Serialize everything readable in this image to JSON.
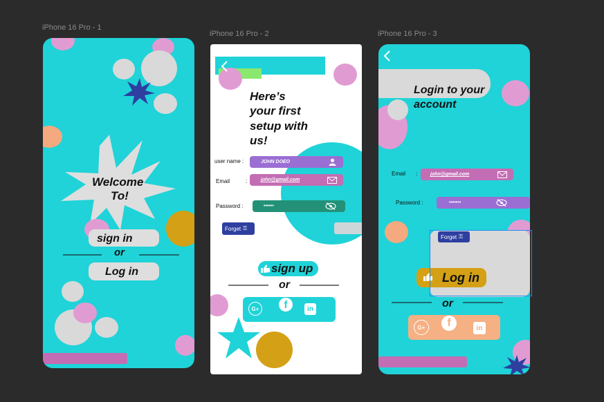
{
  "frames": {
    "one": {
      "label": "iPhone 16 Pro - 1"
    },
    "two": {
      "label": "iPhone 16 Pro - 2"
    },
    "three": {
      "label": "iPhone 16 Pro - 3"
    }
  },
  "screen1": {
    "welcome_line1": "Welcome",
    "welcome_line2": "To!",
    "signin_label": "sign  in",
    "or_label": "or",
    "login_label": "Log in"
  },
  "screen2": {
    "heading_l1": "Here’s",
    "heading_l2": "your first",
    "heading_l3": "setup with",
    "heading_l4": "us!",
    "username_label": "user name :",
    "username_value": "JOHN  DOEO",
    "email_label": "Email",
    "email_colon": ":",
    "email_value": "john@gmail.com",
    "password_label": "Password  :",
    "password_value": "••••••",
    "forget_label": "Forget",
    "signup_label": "sign up",
    "or_label": "or"
  },
  "screen3": {
    "heading_l1": "Login to your",
    "heading_l2": "account",
    "email_label": "Email",
    "email_colon": ":",
    "email_value": "john@gmail.com",
    "password_label": "Password  :",
    "password_value": "•••••••",
    "forget_label": "Forget",
    "login_label": "Log in",
    "or_label": "or"
  },
  "icons": {
    "google": "G+",
    "facebook": "f",
    "linkedin": "in"
  },
  "colors": {
    "canvas": "#2b2b2b",
    "teal": "#1fd3d8",
    "pink": "#e19bd3",
    "gray_blob": "#d9d9d9",
    "navy_star": "#2e3fa0",
    "orange": "#f5a97f",
    "mustard": "#d4a015",
    "purple_field": "#9a6ed3",
    "magenta_field": "#c36db4",
    "green_field": "#239178",
    "lime": "#8be86e",
    "peach_social": "#f5b083",
    "selection": "#1e8cf0"
  }
}
